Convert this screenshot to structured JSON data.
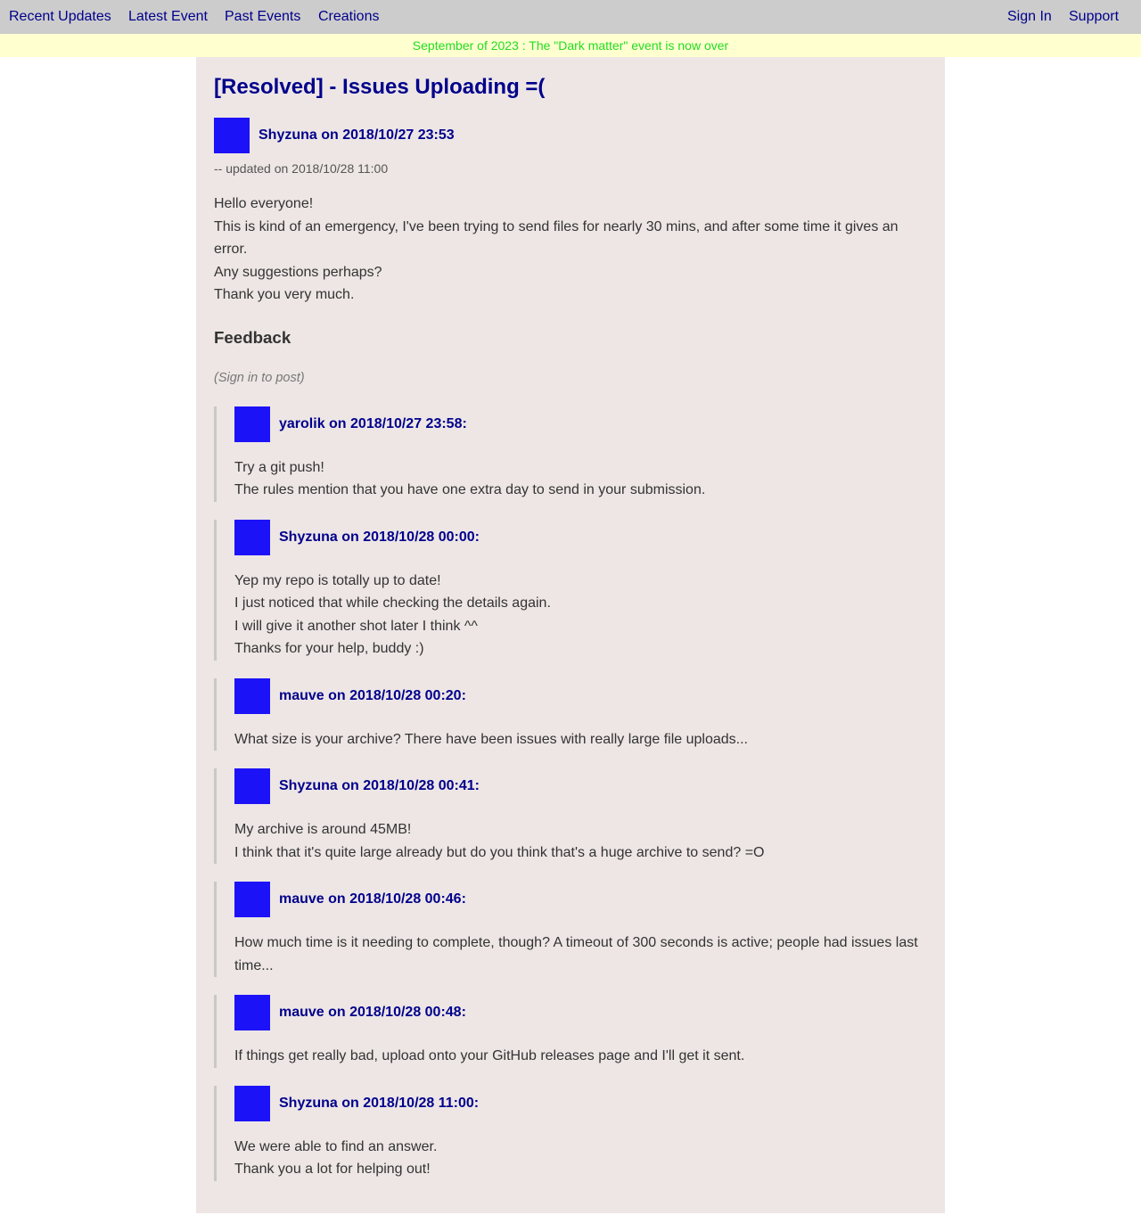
{
  "nav": {
    "left": [
      "Recent Updates",
      "Latest Event",
      "Past Events",
      "Creations"
    ],
    "right": [
      "Sign In",
      "Support"
    ]
  },
  "banner": "September of 2023 : The \"Dark matter\" event is now over",
  "post": {
    "title": "[Resolved] - Issues Uploading =(",
    "author_line": "Shyzuna on 2018/10/27 23:53",
    "updated": "-- updated on 2018/10/28 11:00",
    "body": [
      "Hello everyone!",
      "This is kind of an emergency, I've been trying to send files for nearly 30 mins, and after some time it gives an error.",
      "Any suggestions perhaps?",
      "Thank you very much."
    ]
  },
  "feedback": {
    "heading": "Feedback",
    "signin_note": "(Sign in to post)",
    "comments": [
      {
        "author_line": "yarolik on 2018/10/27 23:58:",
        "lines": [
          "Try a git push!",
          "The rules mention that you have one extra day to send in your submission."
        ]
      },
      {
        "author_line": "Shyzuna on 2018/10/28 00:00:",
        "lines": [
          "Yep my repo is totally up to date!",
          "I just noticed that while checking the details again.",
          "I will give it another shot later I think ^^",
          "Thanks for your help, buddy :)"
        ]
      },
      {
        "author_line": "mauve on 2018/10/28 00:20:",
        "lines": [
          "What size is your archive? There have been issues with really large file uploads..."
        ]
      },
      {
        "author_line": "Shyzuna on 2018/10/28 00:41:",
        "lines": [
          "My archive is around 45MB!",
          "I think that it's quite large already but do you think that's a huge archive to send? =O"
        ]
      },
      {
        "author_line": "mauve on 2018/10/28 00:46:",
        "lines": [
          "How much time is it needing to complete, though? A timeout of 300 seconds is active; people had issues last time..."
        ]
      },
      {
        "author_line": "mauve on 2018/10/28 00:48:",
        "lines": [
          "If things get really bad, upload onto your GitHub releases page and I'll get it sent."
        ]
      },
      {
        "author_line": "Shyzuna on 2018/10/28 11:00:",
        "lines": [
          "We were able to find an answer.",
          "Thank you a lot for helping out!"
        ]
      }
    ]
  },
  "colors": {
    "nav_bg": "#cccccc",
    "link": "#00008b",
    "banner_bg": "#ffffd0",
    "banner_text": "#22dd22",
    "content_bg": "#ede6e5",
    "avatar": "#1c12f7"
  }
}
